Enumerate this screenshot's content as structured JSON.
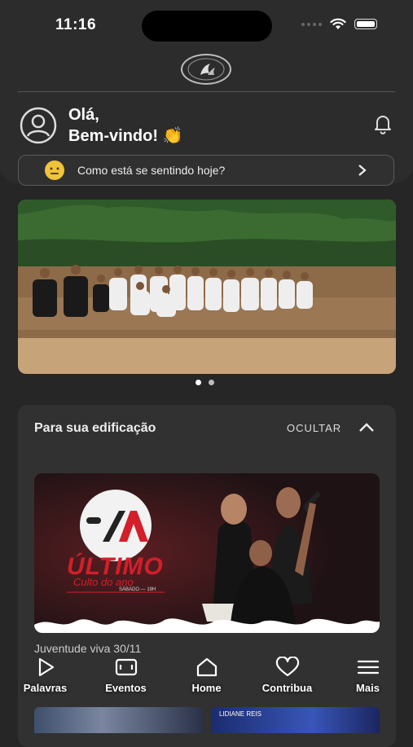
{
  "status": {
    "time": "11:16"
  },
  "header": {
    "greeting_line1": "Olá,",
    "greeting_line2": "Bem-vindo! 👏"
  },
  "mood_prompt": {
    "text": "Como está se sentindo hoje?"
  },
  "banner": {
    "pages": 2,
    "active_page": 1
  },
  "edification": {
    "title": "Para sua edificação",
    "hide_label": "OCULTAR",
    "video": {
      "title_line1": "ÚLTIMO",
      "title_line2": "Culto do ano",
      "day_line": "SÁBADO — 19H",
      "caption": "Juventude viva 30/11"
    },
    "next_thumb_label": "LIDIANE REIS"
  },
  "nav": {
    "items": [
      {
        "label": "Palavras",
        "icon": "play-icon"
      },
      {
        "label": "Eventos",
        "icon": "calendar-icon"
      },
      {
        "label": "Home",
        "icon": "home-icon"
      },
      {
        "label": "Contribua",
        "icon": "heart-icon"
      },
      {
        "label": "Mais",
        "icon": "menu-icon"
      }
    ]
  },
  "colors": {
    "background": "#262626",
    "panel": "#2c2c2c",
    "card": "#313131",
    "accent_red": "#d41e2a"
  }
}
